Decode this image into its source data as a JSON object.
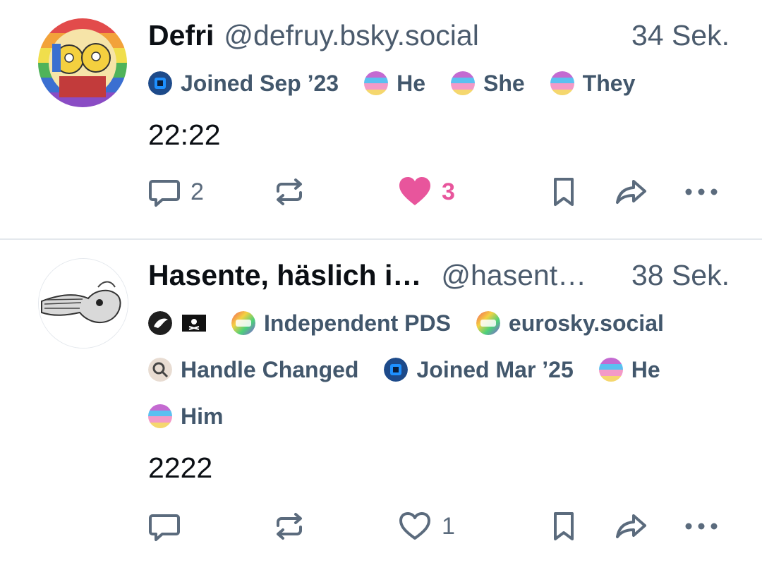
{
  "posts": [
    {
      "name": "Defri",
      "handle": "@defruy.bsky.social",
      "time": "34 Sek.",
      "badges": [
        "Joined Sep ’23",
        "He",
        "She",
        "They"
      ],
      "text": "22:22",
      "reply_count": "2",
      "like_count": "3",
      "liked": true
    },
    {
      "name": "Hasente, häslich i…",
      "handle": "@hasent…",
      "time": "38 Sek.",
      "badges": [
        "Independent PDS",
        "eurosky.social",
        "Handle Changed",
        "Joined Mar ’25",
        "He",
        "Him"
      ],
      "text": "2222",
      "reply_count": "",
      "like_count": "1",
      "liked": false
    }
  ],
  "icons": {
    "reply": "speech-bubble-icon",
    "repost": "repost-arrows-icon",
    "like": "heart-icon",
    "bookmark": "bookmark-icon",
    "share": "share-arrow-icon",
    "more": "ellipsis-icon"
  },
  "colors": {
    "like_active": "#e8559c",
    "muted": "#5b6b7d",
    "badge_text": "#42576c"
  }
}
